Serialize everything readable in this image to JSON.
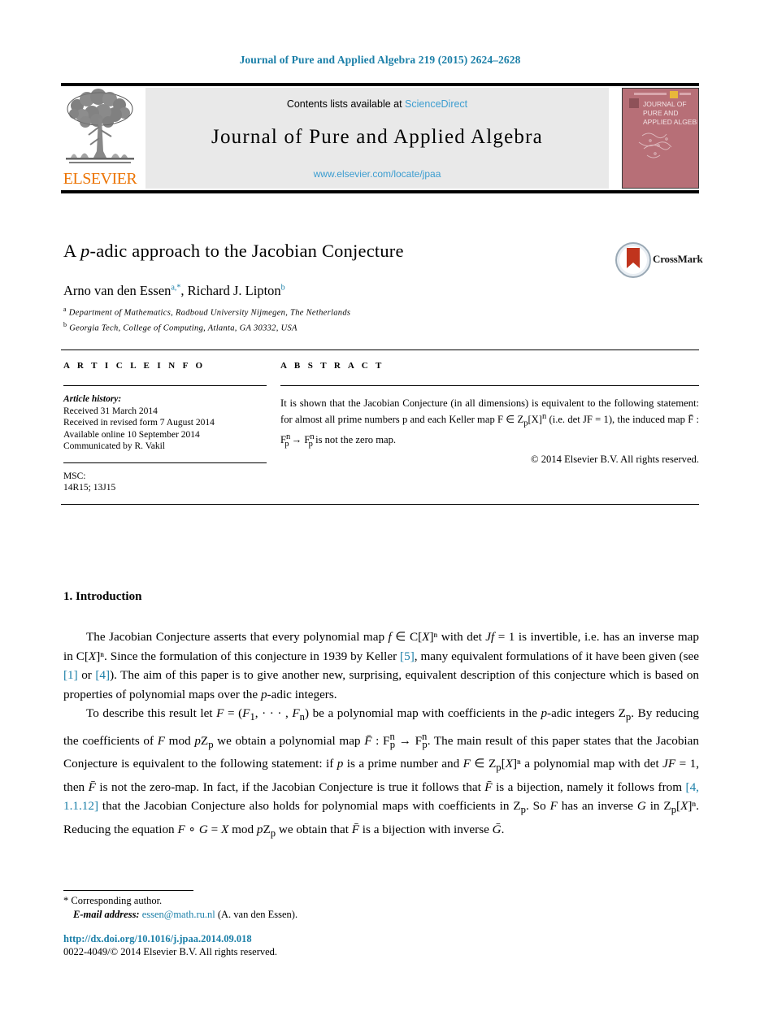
{
  "running_head": "Journal of Pure and Applied Algebra 219 (2015) 2624–2628",
  "masthead": {
    "publisher": "ELSEVIER",
    "contents_prefix": "Contents lists available at ",
    "sciencedirect": "ScienceDirect",
    "journal_title": "Journal of Pure and Applied Algebra",
    "journal_url": "www.elsevier.com/locate/jpaa",
    "cover_line1": "JOURNAL OF",
    "cover_line2": "PURE AND",
    "cover_line3": "APPLIED ALGEBRA"
  },
  "crossmark": {
    "label": "CrossMark"
  },
  "article": {
    "title_pre": "A ",
    "title_italic": "p",
    "title_post": "-adic approach to the Jacobian Conjecture",
    "authors": "Arno van den Essen",
    "author1_marks": "a,*",
    "authors2": ", Richard J. Lipton",
    "author2_marks": "b",
    "affiliation_a_mark": "a",
    "affiliation_a": "Department of Mathematics, Radboud University Nijmegen, The Netherlands",
    "affiliation_b_mark": "b",
    "affiliation_b": "Georgia Tech, College of Computing, Atlanta, GA 30332, USA"
  },
  "info": {
    "label": "A R T I C L E   I N F O",
    "history_header": "Article history:",
    "received": "Received 31 March 2014",
    "revised": "Received in revised form 7 August 2014",
    "available": "Available online 10 September 2014",
    "communicated": "Communicated by R. Vakil",
    "msc_header": "MSC:",
    "msc_codes": "14R15; 13J15"
  },
  "abstract": {
    "label": "A B S T R A C T",
    "line1": "It is shown that the Jacobian Conjecture (in all dimensions) is equivalent to the",
    "line2": "following statement: for almost all prime numbers p and each Keller map F ∈ Z",
    "line2_sub": "p",
    "line2_end": "[X]",
    "line2_sup": "n",
    "line3": "(i.e. det JF = 1), the induced map F̄ : F",
    "line3_sub": "p",
    "line3_sup": "n",
    "line3_mid": " → F",
    "line3_end": " is not the zero map.",
    "copyright": "© 2014 Elsevier B.V. All rights reserved."
  },
  "body": {
    "section_number": "1.",
    "section_title": "Introduction",
    "p1": {
      "t1": "The Jacobian Conjecture asserts that every polynomial map ",
      "m1": "f",
      "t2": " ∈ C[",
      "m2": "X",
      "t3": "]ⁿ with det ",
      "m3": "Jf",
      "t4": " = 1 is invertible, i.e. has an inverse map in C[",
      "m4": "X",
      "t5": "]ⁿ. Since the formulation of this conjecture in 1939 by Keller ",
      "r1": "[5]",
      "t6": ", many equivalent formulations of it have been given (see ",
      "r2": "[1]",
      "t7": " or ",
      "r3": "[4]",
      "t8": "). The aim of this paper is to give another new, surprising, equivalent description of this conjecture which is based on properties of polynomial maps over the ",
      "m5": "p",
      "t9": "-adic integers."
    },
    "p2": {
      "t1": "To describe this result let ",
      "m1": "F",
      "t2": " = (",
      "m2": "F",
      "sub1": "1",
      "t3": ", · · · , ",
      "m3": "F",
      "sub2": "n",
      "t4": ") be a polynomial map with coefficients in the ",
      "m4": "p",
      "t5": "-adic integers Z",
      "sub3": "p",
      "t6": ". By reducing the coefficients of ",
      "m5": "F",
      "t7": " mod ",
      "m6": "p",
      "t8": "Z",
      "sub4": "p",
      "t9": " we obtain a polynomial map ",
      "m7": "F̄",
      "t10": " : F",
      "t11": " → F",
      "t12": ". The main result of this paper states that the Jacobian Conjecture is equivalent to the following statement: if ",
      "m8": "p",
      "t13": " is a prime number and ",
      "m9": "F",
      "t14": " ∈ Z",
      "t15": "[",
      "m10": "X",
      "t16": "]ⁿ a polynomial map with det ",
      "m11": "JF",
      "t17": " = 1, then ",
      "m12": "F̄",
      "t18": " is not the zero-map. In fact, if the Jacobian Conjecture is true it follows that ",
      "m13": "F̄",
      "t19": " is a bijection, namely it follows from ",
      "r1": "[4, 1.1.12]",
      "t20": " that the Jacobian Conjecture also holds for polynomial maps with coefficients in Z",
      "t21": ". So ",
      "m14": "F",
      "t22": " has an inverse ",
      "m15": "G",
      "t23": " in Z",
      "t24": "[",
      "m16": "X",
      "t25": "]ⁿ. Reducing the equation ",
      "m17": "F",
      "t26": " ∘ ",
      "m18": "G",
      "t27": " = ",
      "m19": "X",
      "t28": " mod ",
      "m20": "p",
      "t29": "Z",
      "t30": " we obtain that ",
      "m21": "F̄",
      "t31": " is a bijection with inverse ",
      "m22": "Ḡ",
      "t32": "."
    }
  },
  "footer": {
    "corresponding_star": "*",
    "corresponding": "Corresponding author.",
    "email_label": "E-mail address:",
    "email": "essen@math.ru.nl",
    "email_suffix": "(A. van den Essen).",
    "doi": "http://dx.doi.org/10.1016/j.jpaa.2014.09.018",
    "issn": "0022-4049/© 2014 Elsevier B.V. All rights reserved."
  },
  "colors": {
    "link": "#1b7fa8",
    "sciencedirect": "#3c9dd0",
    "elsevier_orange": "#ec7404",
    "cover": "#b76f77",
    "masthead_bg": "#e9e9e9"
  }
}
